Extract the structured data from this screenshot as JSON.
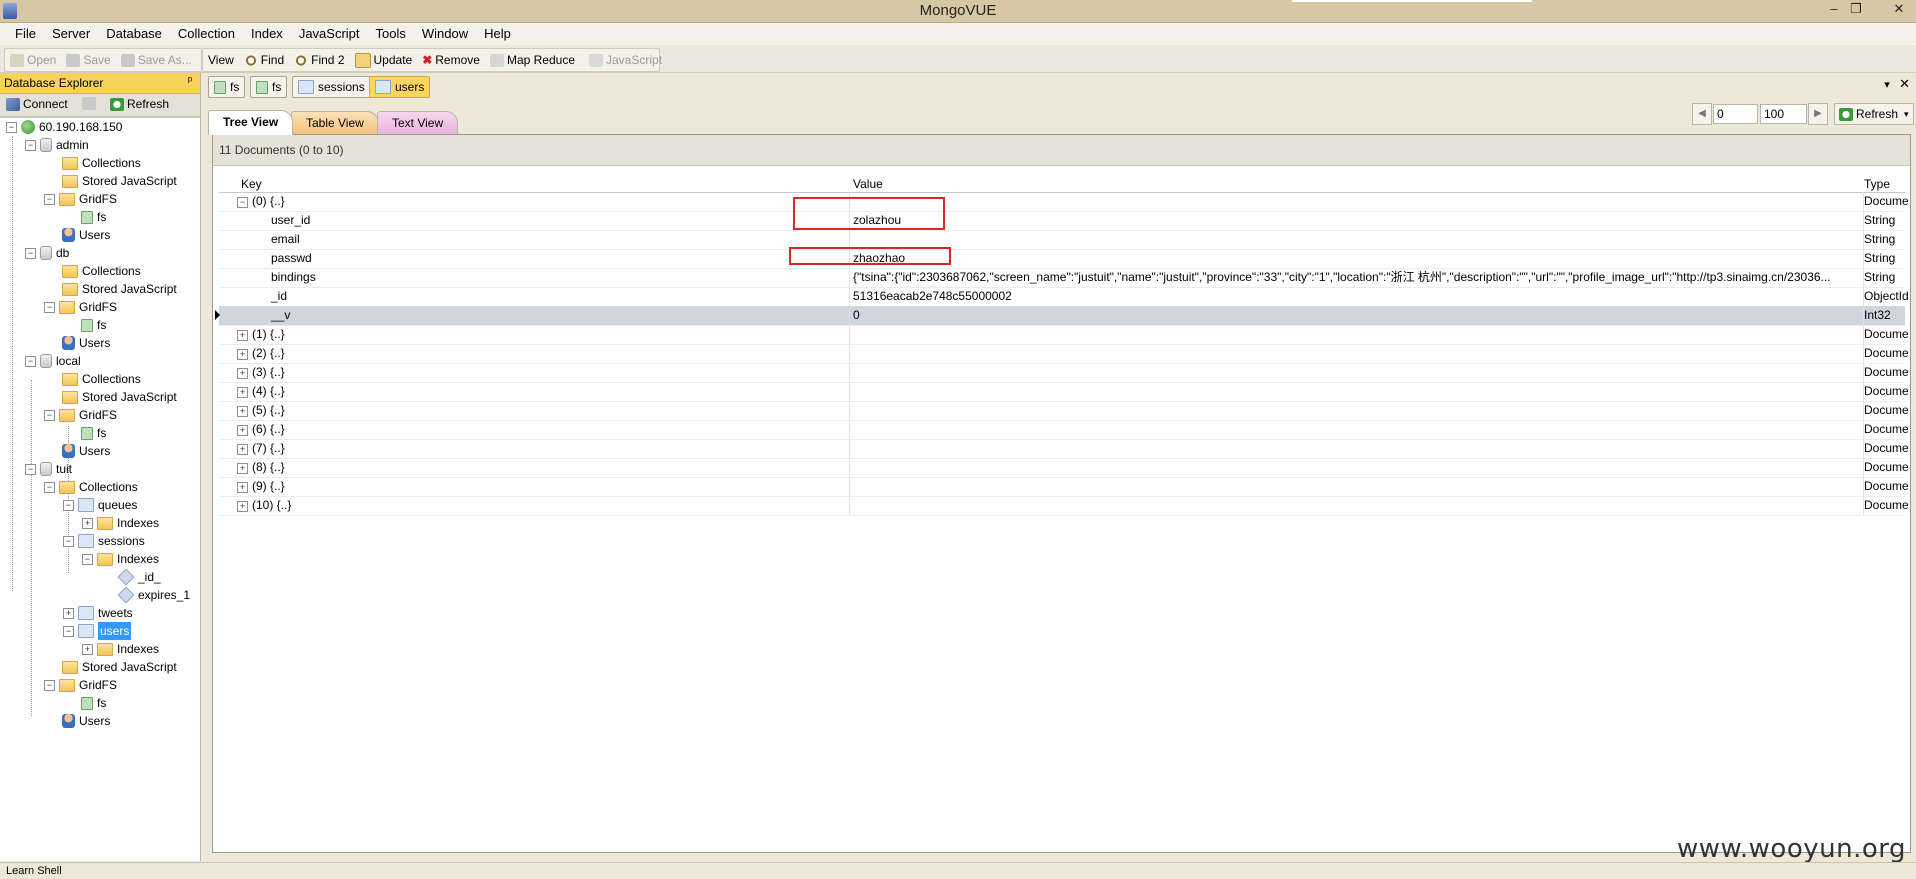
{
  "window": {
    "title": "MongoVUE",
    "min": "–",
    "restore": "❐",
    "close": "✕"
  },
  "menu": [
    "File",
    "Server",
    "Database",
    "Collection",
    "Index",
    "JavaScript",
    "Tools",
    "Window",
    "Help"
  ],
  "toolbar": {
    "open": "Open",
    "save": "Save",
    "save_as": "Save As...",
    "view": "View",
    "find": "Find",
    "find2": "Find 2",
    "update": "Update",
    "remove": "Remove",
    "map_reduce": "Map Reduce",
    "javascript": "JavaScript"
  },
  "explorer": {
    "title": "Database Explorer",
    "pin": "ᵖ",
    "connect": "Connect",
    "refresh": "Refresh"
  },
  "tree": [
    "60.190.168.150",
    "admin",
    "Collections",
    "Stored JavaScript",
    "GridFS",
    "fs",
    "Users",
    "db",
    "Collections",
    "Stored JavaScript",
    "GridFS",
    "fs",
    "Users",
    "local",
    "Collections",
    "Stored JavaScript",
    "GridFS",
    "fs",
    "Users",
    "tuit",
    "Collections",
    "queues",
    "Indexes",
    "sessions",
    "Indexes",
    "_id_",
    "expires_1",
    "tweets",
    "users",
    "Indexes",
    "Stored JavaScript",
    "GridFS",
    "fs",
    "Users"
  ],
  "doc_tabs": [
    "fs",
    "fs",
    "sessions",
    "users"
  ],
  "view_tabs": [
    "Tree View",
    "Table View",
    "Text View"
  ],
  "pager": {
    "skip": "0",
    "limit": "100",
    "refresh": "Refresh"
  },
  "doc_count": "11 Documents (0 to 10)",
  "grid": {
    "headers": [
      "Key",
      "Value",
      "Type"
    ],
    "rows": [
      {
        "key": "(0) {..}",
        "value": "",
        "type": "Document"
      },
      {
        "key": "user_id",
        "value": "zolazhou",
        "type": "String"
      },
      {
        "key": "email",
        "value": "",
        "type": "String"
      },
      {
        "key": "passwd",
        "value": "zhaozhao",
        "type": "String"
      },
      {
        "key": "bindings",
        "value": "{\"tsina\":{\"id\":2303687062,\"screen_name\":\"justuit\",\"name\":\"justuit\",\"province\":\"33\",\"city\":\"1\",\"location\":\"浙江 杭州\",\"description\":\"\",\"url\":\"\",\"profile_image_url\":\"http://tp3.sinaimg.cn/23036...",
        "type": "String"
      },
      {
        "key": "_id",
        "value": "51316eacab2e748c55000002",
        "type": "ObjectId"
      },
      {
        "key": "__v",
        "value": "0",
        "type": "Int32"
      },
      {
        "key": "(1) {..}",
        "value": "",
        "type": "Document"
      },
      {
        "key": "(2) {..}",
        "value": "",
        "type": "Document"
      },
      {
        "key": "(3) {..}",
        "value": "",
        "type": "Document"
      },
      {
        "key": "(4) {..}",
        "value": "",
        "type": "Document"
      },
      {
        "key": "(5) {..}",
        "value": "",
        "type": "Document"
      },
      {
        "key": "(6) {..}",
        "value": "",
        "type": "Document"
      },
      {
        "key": "(7) {..}",
        "value": "",
        "type": "Document"
      },
      {
        "key": "(8) {..}",
        "value": "",
        "type": "Document"
      },
      {
        "key": "(9) {..}",
        "value": "",
        "type": "Document"
      },
      {
        "key": "(10) {..}",
        "value": "",
        "type": "Document"
      }
    ]
  },
  "status": "Learn Shell",
  "watermark": "www.wooyun.org",
  "colors": {
    "accent": "#fbd65f",
    "highlight_box": "#e0252a",
    "selection": "#3399ff"
  }
}
